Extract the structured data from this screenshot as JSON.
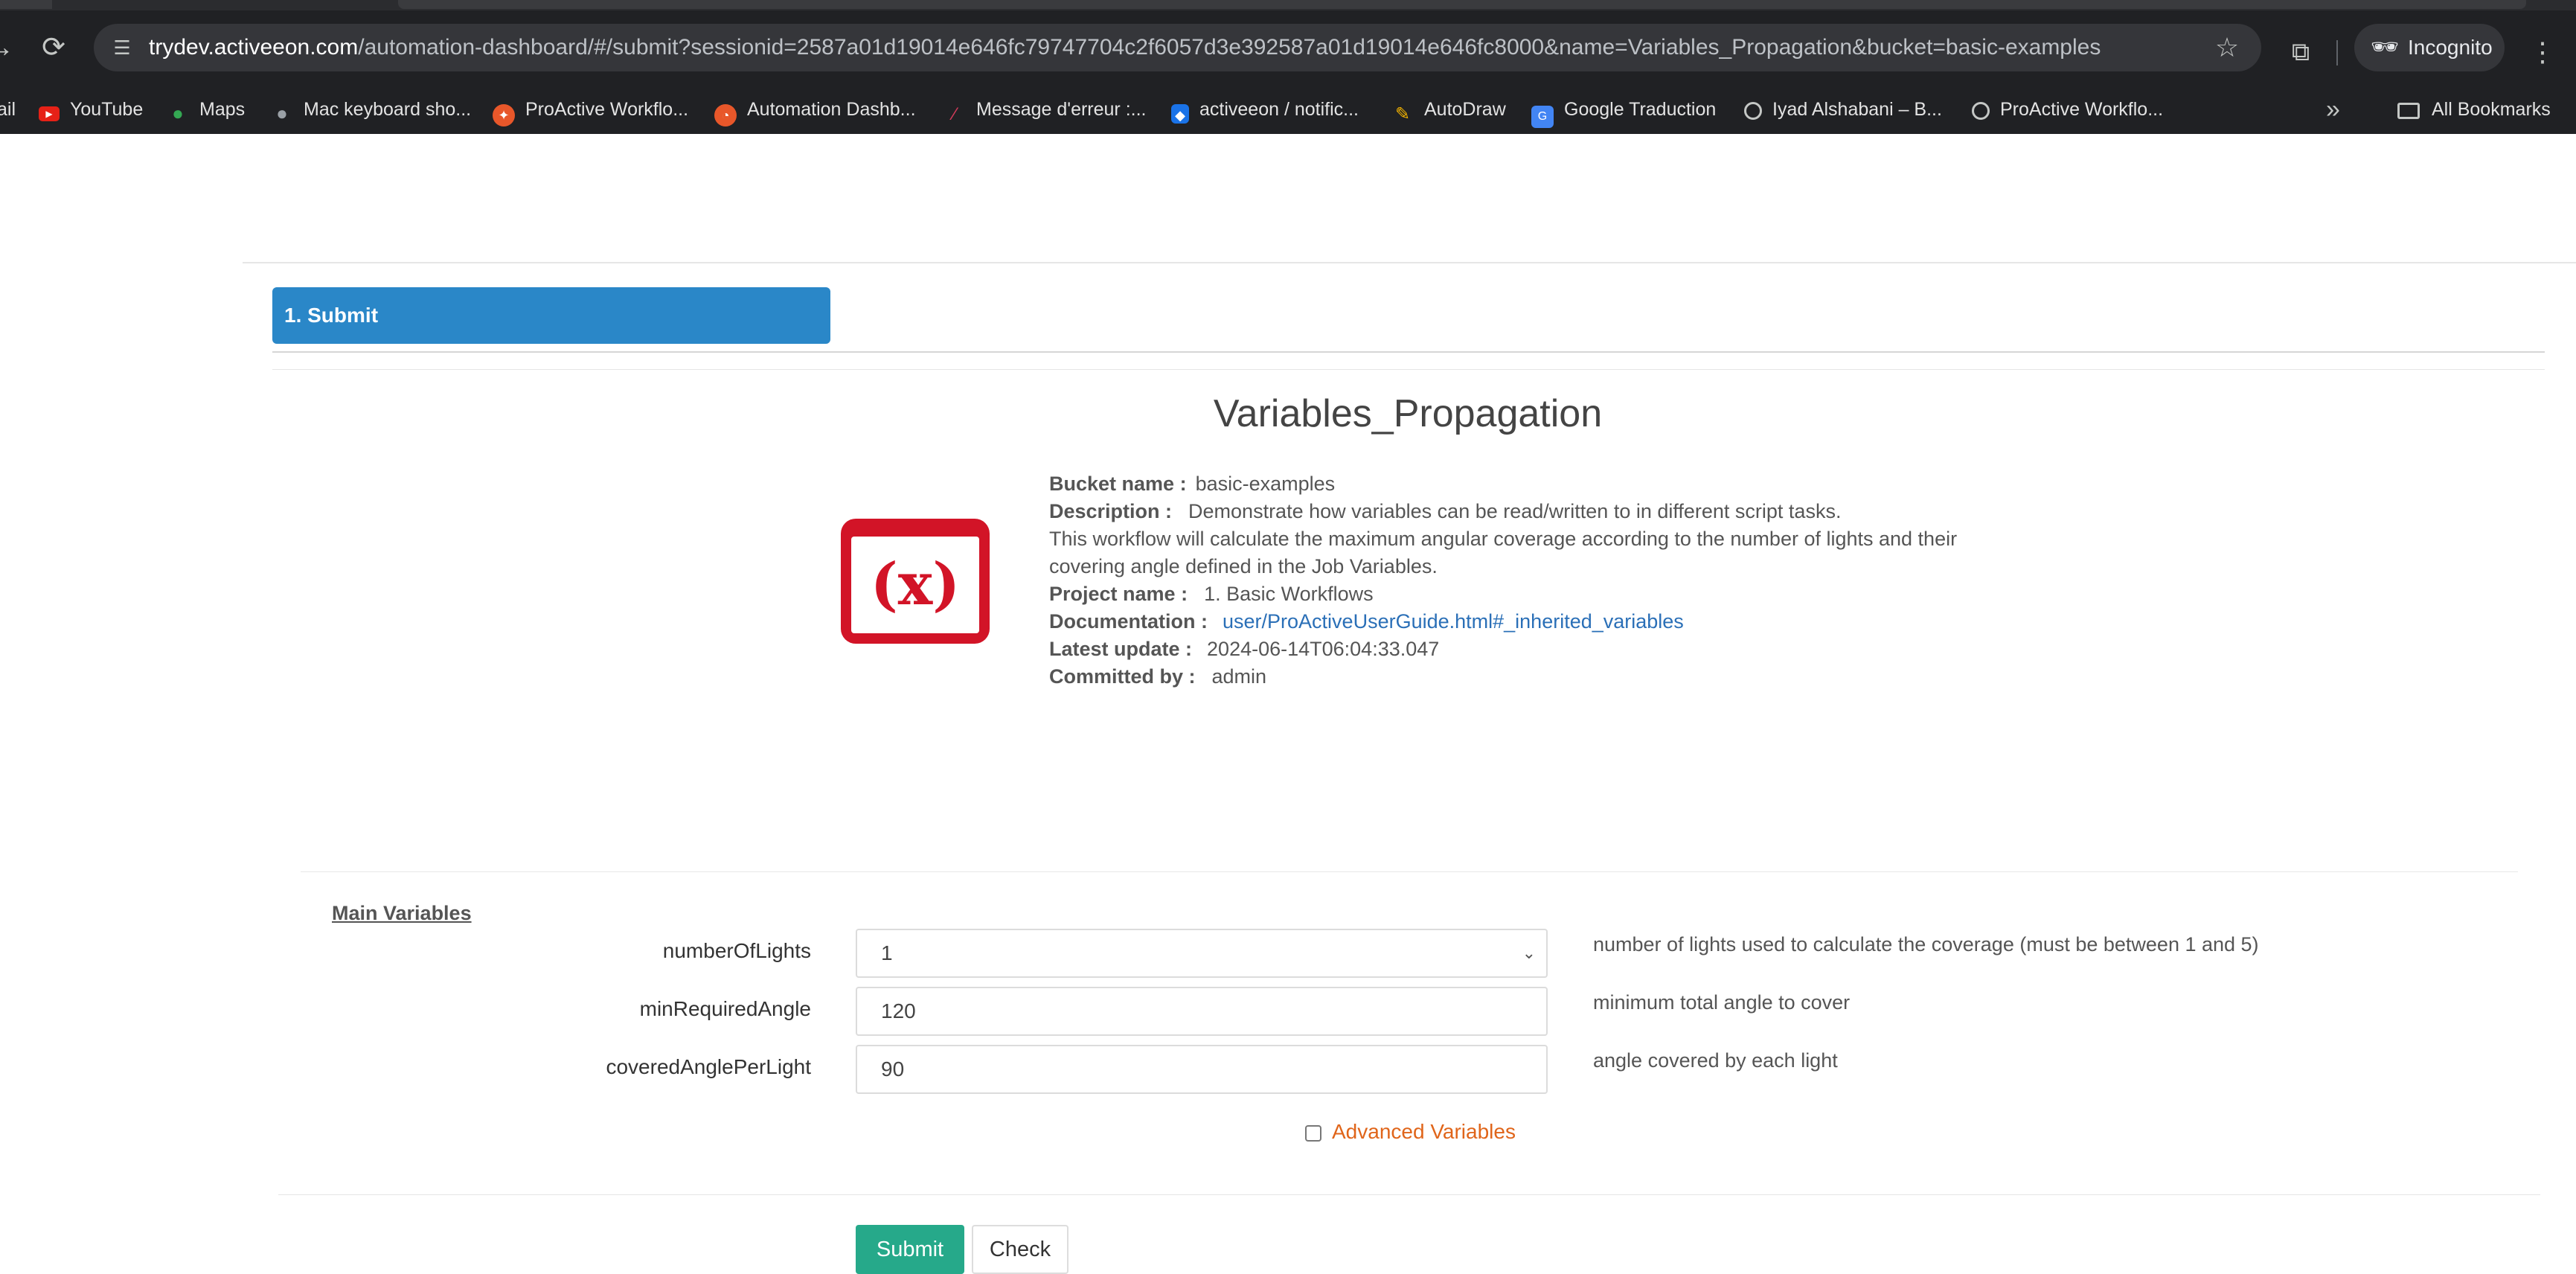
{
  "browser": {
    "url_host": "trydev.activeeon.com",
    "url_rest": "/automation-dashboard/#/submit?sessionid=2587a01d19014e646fc79747704c2f6057d3e392587a01d19014e646fc8000&name=Variables_Propagation&bucket=basic-examples",
    "profile_label": "Incognito",
    "bookmarks": [
      {
        "label": "ail",
        "color": "#202124"
      },
      {
        "label": "YouTube",
        "color": "#e62117"
      },
      {
        "label": "Maps",
        "color": "#34a853"
      },
      {
        "label": "Mac keyboard sho...",
        "color": "#555555"
      },
      {
        "label": "ProActive Workflo...",
        "color": "#e8572a"
      },
      {
        "label": "Automation Dashb...",
        "color": "#e8572a"
      },
      {
        "label": "Message d'erreur :...",
        "color": "#d43b5a"
      },
      {
        "label": "activeeon / notific...",
        "color": "#1a73e8"
      },
      {
        "label": "AutoDraw",
        "color": "#f4b400"
      },
      {
        "label": "Google Traduction",
        "color": "#4285f4"
      },
      {
        "label": "Iyad Alshabani – B...",
        "color": "#666666"
      },
      {
        "label": "ProActive Workflo...",
        "color": "#666666"
      }
    ],
    "all_bookmarks_label": "All Bookmarks"
  },
  "wizard": {
    "step_label": "1. Submit"
  },
  "workflow": {
    "title": "Variables_Propagation",
    "logo_text": "(x)",
    "info": [
      {
        "key": "Bucket name :",
        "value": "basic-examples"
      },
      {
        "key": "Description :",
        "value": "Demonstrate how variables can be read/written to in different script tasks."
      }
    ],
    "description_lines": [
      "This workflow will calculate the maximum angular coverage according to the number of lights and their",
      "covering angle defined in the Job Variables."
    ],
    "project_key": "Project name :",
    "project_value": "1. Basic Workflows",
    "doc_key": "Documentation :",
    "doc_link": "user/ProActiveUserGuide.html#_inherited_variables",
    "update_key": "Latest update :",
    "update_value": "2024-06-14T06:04:33.047",
    "committed_key": "Committed by :",
    "committed_value": "admin"
  },
  "variables": {
    "section_title": "Main Variables",
    "items": [
      {
        "name": "numberOfLights",
        "value": "1",
        "description": "number of lights used to calculate the coverage (must be between 1 and 5)"
      },
      {
        "name": "minRequiredAngle",
        "value": "120",
        "description": "minimum total angle to cover"
      },
      {
        "name": "coveredAnglePerLight",
        "value": "90",
        "description": "angle covered by each light"
      }
    ],
    "advanced_label": "Advanced Variables"
  },
  "actions": {
    "submit_label": "Submit",
    "check_label": "Check"
  },
  "colors": {
    "step_tab": "#2a87c8",
    "submit_button": "#26a98a",
    "logo": "#d21427",
    "advanced_link": "#e0651a",
    "doc_link": "#2a6fb7"
  }
}
